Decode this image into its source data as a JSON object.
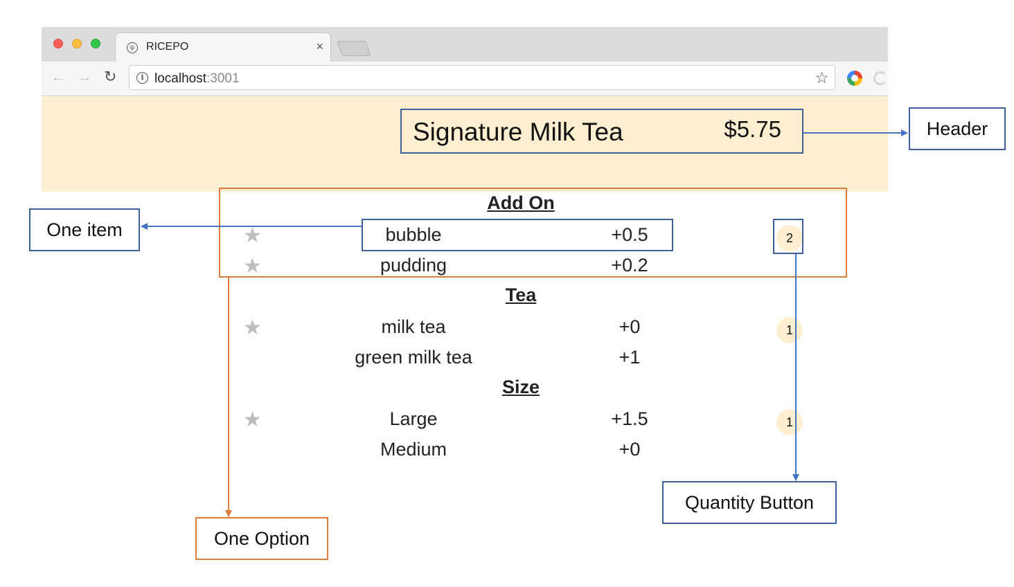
{
  "browser": {
    "tab_title": "RICEPO",
    "tab_close": "×",
    "url_host": "localhost",
    "url_port": ":3001"
  },
  "header": {
    "item_name": "Signature Milk Tea",
    "item_price": "$5.75",
    "background_color": "#feefd1"
  },
  "groups": [
    {
      "title": "Add On",
      "options": [
        {
          "name": "bubble",
          "price": "+0.5"
        },
        {
          "name": "pudding",
          "price": "+0.2"
        }
      ],
      "quantity": "2"
    },
    {
      "title": "Tea",
      "options": [
        {
          "name": "milk tea",
          "price": "+0"
        },
        {
          "name": "green milk tea",
          "price": "+1"
        }
      ],
      "quantity": "1"
    },
    {
      "title": "Size",
      "options": [
        {
          "name": "Large",
          "price": "+1.5"
        },
        {
          "name": "Medium",
          "price": "+0"
        }
      ],
      "quantity": "1"
    }
  ],
  "annotations": {
    "header": "Header",
    "one_item": "One item",
    "one_option": "One Option",
    "quantity_button": "Quantity Button",
    "colors": {
      "blue": "#3f5f9a",
      "orange": "#e07b39"
    }
  }
}
